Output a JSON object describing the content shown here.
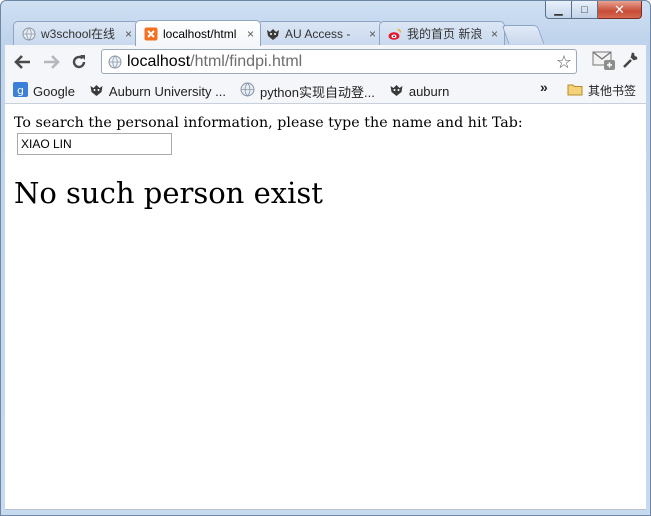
{
  "window_controls": {
    "minimize": "▁",
    "maximize": "□",
    "close": "✕"
  },
  "tabs": [
    {
      "title": "w3school在线",
      "icon": "globe-icon",
      "close": "×"
    },
    {
      "title": "localhost/html",
      "icon": "xampp-icon",
      "close": "×",
      "active": true
    },
    {
      "title": "AU Access -",
      "icon": "auburn-tiger-icon",
      "close": "×"
    },
    {
      "title": "我的首页 新浪",
      "icon": "weibo-icon",
      "close": "×"
    }
  ],
  "toolbar": {
    "url_host": "localhost",
    "url_path": "/html/findpi.html"
  },
  "bookmarks": {
    "items": [
      {
        "label": "Google",
        "icon": "google-icon"
      },
      {
        "label": "Auburn University ...",
        "icon": "auburn-tiger-icon"
      },
      {
        "label": "python实现自动登...",
        "icon": "globe-icon"
      },
      {
        "label": "auburn",
        "icon": "auburn-tiger-icon"
      }
    ],
    "more": "»",
    "other_bookmarks": "其他书签"
  },
  "page": {
    "instruction": "To search the personal information, please type the name and hit Tab:",
    "name_value": "XIAO LIN",
    "result": "No such person exist"
  },
  "colors": {
    "frame": "#c7daf0",
    "xampp_orange": "#f37021",
    "close_red": "#c74b36"
  }
}
